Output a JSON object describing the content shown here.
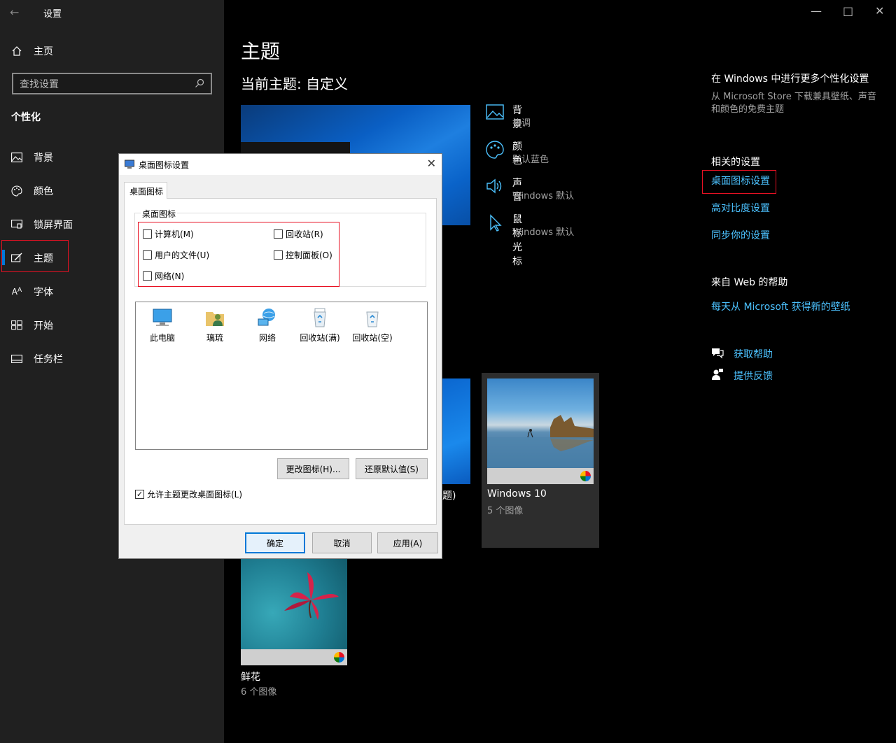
{
  "app": {
    "title": "设置"
  },
  "sidebar": {
    "home": "主页",
    "search_placeholder": "查找设置",
    "section": "个性化",
    "items": [
      {
        "label": "背景",
        "icon": "picture-icon"
      },
      {
        "label": "颜色",
        "icon": "palette-icon"
      },
      {
        "label": "锁屏界面",
        "icon": "lockscreen-icon"
      },
      {
        "label": "主题",
        "icon": "theme-brush-icon",
        "selected": true
      },
      {
        "label": "字体",
        "icon": "font-icon"
      },
      {
        "label": "开始",
        "icon": "start-icon"
      },
      {
        "label": "任务栏",
        "icon": "taskbar-icon"
      }
    ]
  },
  "main": {
    "title": "主题",
    "current_theme": "当前主题: 自定义",
    "properties": [
      {
        "label": "背景",
        "value": "协调"
      },
      {
        "label": "颜色",
        "value": "默认蓝色"
      },
      {
        "label": "声音",
        "value": "Windows 默认"
      },
      {
        "label": "鼠标光标",
        "value": "Windows 默认"
      }
    ],
    "themes": [
      {
        "name": "Windows 10",
        "count": "5 个图像"
      },
      {
        "name": "鲜花",
        "count": "6 个图像"
      }
    ],
    "partial_theme_text": "题)"
  },
  "right": {
    "personalize_heading": "在 Windows 中进行更多个性化设置",
    "personalize_desc": "从 Microsoft Store 下载兼具壁纸、声音和颜色的免费主题",
    "related_heading": "相关的设置",
    "related_links": [
      "桌面图标设置",
      "高对比度设置",
      "同步你的设置"
    ],
    "web_heading": "来自 Web 的帮助",
    "web_link": "每天从 Microsoft 获得新的壁纸",
    "help": "获取帮助",
    "feedback": "提供反馈"
  },
  "dialog": {
    "title": "桌面图标设置",
    "tab": "桌面图标",
    "group": "桌面图标",
    "checkboxes": [
      {
        "label": "计算机(M)",
        "checked": false
      },
      {
        "label": "回收站(R)",
        "checked": false
      },
      {
        "label": "用户的文件(U)",
        "checked": false
      },
      {
        "label": "控制面板(O)",
        "checked": false
      },
      {
        "label": "网络(N)",
        "checked": false
      }
    ],
    "icons": [
      "此电脑",
      "璃琉",
      "网络",
      "回收站(满)",
      "回收站(空)"
    ],
    "change_icon": "更改图标(H)...",
    "restore_default": "还原默认值(S)",
    "allow_themes": "允许主题更改桌面图标(L)",
    "allow_themes_checked": true,
    "ok": "确定",
    "cancel": "取消",
    "apply": "应用(A)"
  },
  "colors": {
    "accent": "#0078d7",
    "link": "#4cc2ff",
    "highlight": "#e81123"
  }
}
